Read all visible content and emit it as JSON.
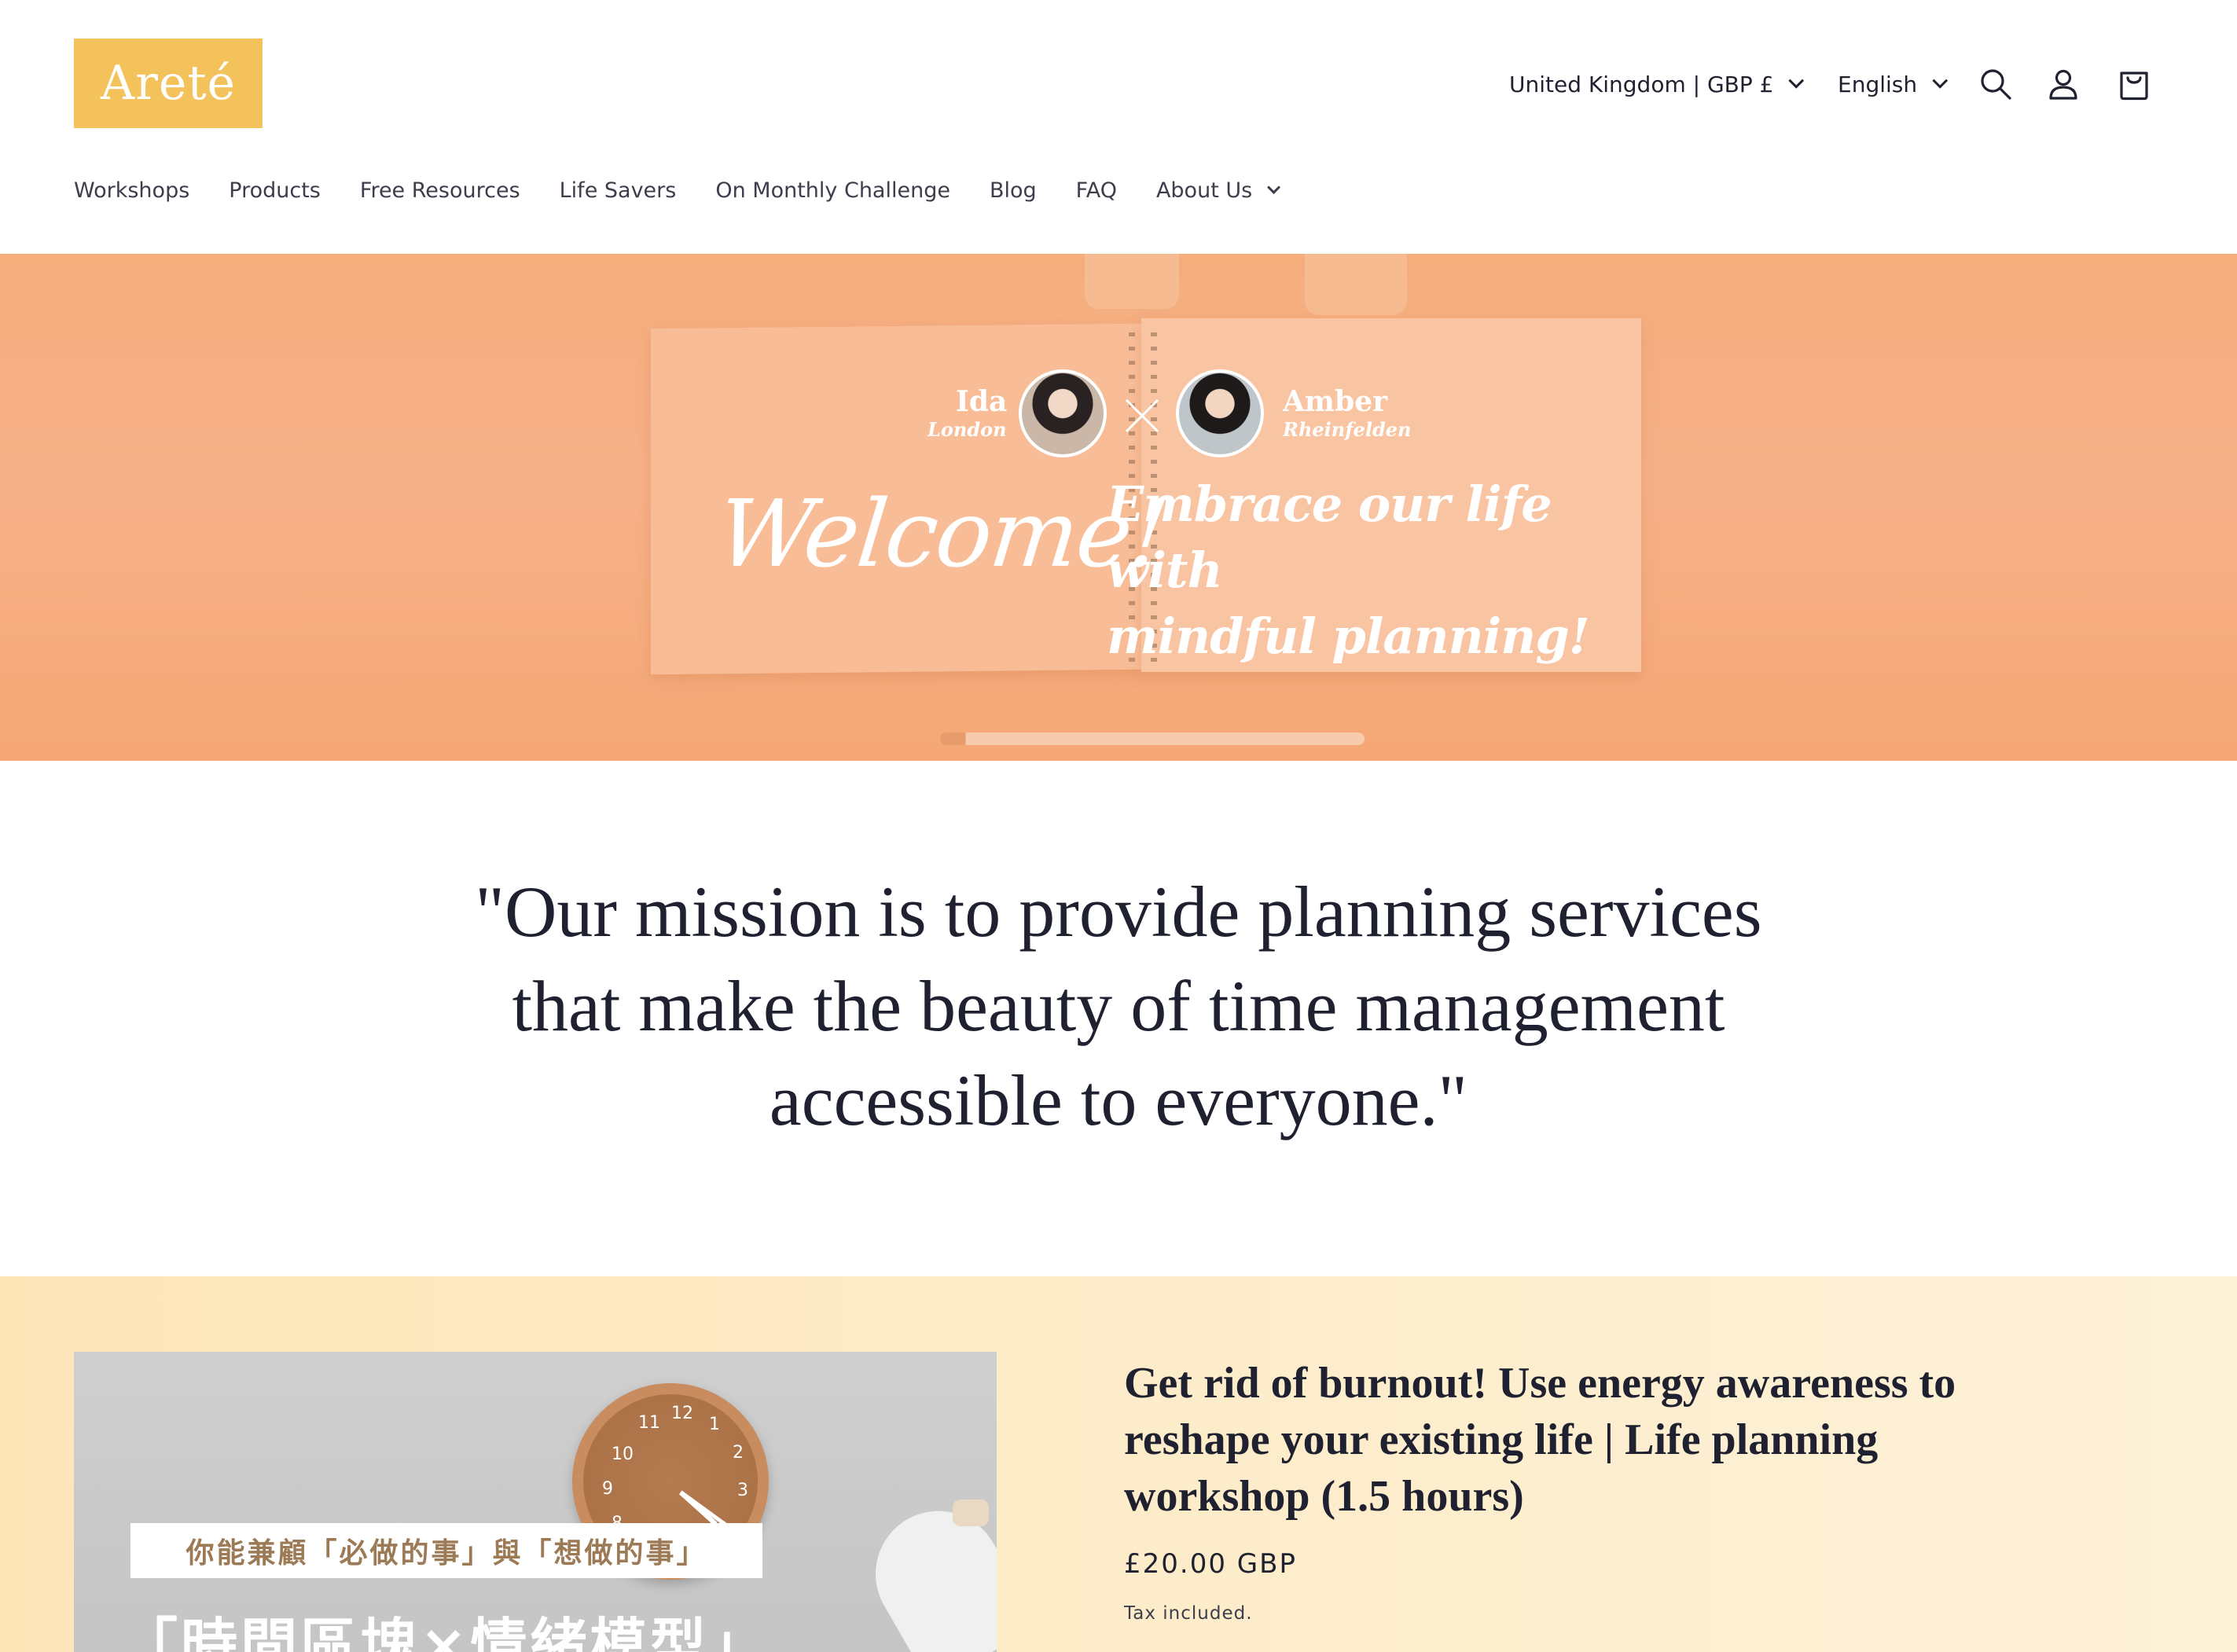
{
  "header": {
    "logo": "Areté",
    "country_selector": "United Kingdom | GBP £",
    "language_selector": "English",
    "icons": [
      "search-icon",
      "account-icon",
      "cart-icon"
    ]
  },
  "nav": {
    "items": [
      {
        "label": "Workshops"
      },
      {
        "label": "Products"
      },
      {
        "label": "Free Resources"
      },
      {
        "label": "Life Savers"
      },
      {
        "label": "On Monthly Challenge"
      },
      {
        "label": "Blog"
      },
      {
        "label": "FAQ"
      },
      {
        "label": "About Us",
        "has_dropdown": true
      }
    ]
  },
  "hero": {
    "person1": {
      "name": "Ida",
      "city": "London"
    },
    "person2": {
      "name": "Amber",
      "city": "Rheinfelden"
    },
    "welcome": "Welcome!",
    "tagline_line1": "Embrace our life with",
    "tagline_line2": "mindful planning!"
  },
  "mission": {
    "quote": "\"Our mission is to provide planning services that make the beauty of time management accessible to everyone.\""
  },
  "product": {
    "image_subtitle_zh": "你能兼顧「必做的事」與「想做的事」",
    "image_title_zh": "「時間區塊×情緒模型」",
    "clock_numbers": [
      "11",
      "12",
      "1",
      "2",
      "10",
      "9",
      "3",
      "8"
    ],
    "title": "Get rid of burnout! Use energy awareness to reshape your existing life | Life planning workshop (1.5 hours)",
    "price": "£20.00 GBP",
    "tax_note": "Tax included."
  },
  "colors": {
    "logo_bg": "#f3c25b",
    "hero_bg": "#f5ad7c",
    "text": "#1f2130",
    "product_bg": "#fde6b8"
  }
}
